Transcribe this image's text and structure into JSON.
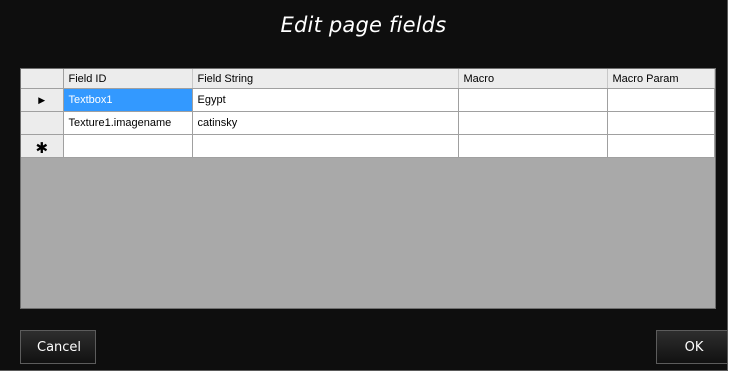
{
  "dialog": {
    "title": "Edit page fields"
  },
  "grid": {
    "columns": [
      "Field ID",
      "Field String",
      "Macro",
      "Macro Param"
    ],
    "rows": [
      {
        "marker": "current-row",
        "cells": [
          "Textbox1",
          "Egypt",
          "",
          ""
        ]
      },
      {
        "marker": "",
        "cells": [
          "Texture1.imagename",
          "catinsky",
          "",
          ""
        ]
      },
      {
        "marker": "new-row",
        "cells": [
          "",
          "",
          "",
          ""
        ]
      }
    ],
    "selected_cell": "Textbox1"
  },
  "buttons": {
    "cancel_label": "Cancel",
    "ok_label": "OK"
  }
}
